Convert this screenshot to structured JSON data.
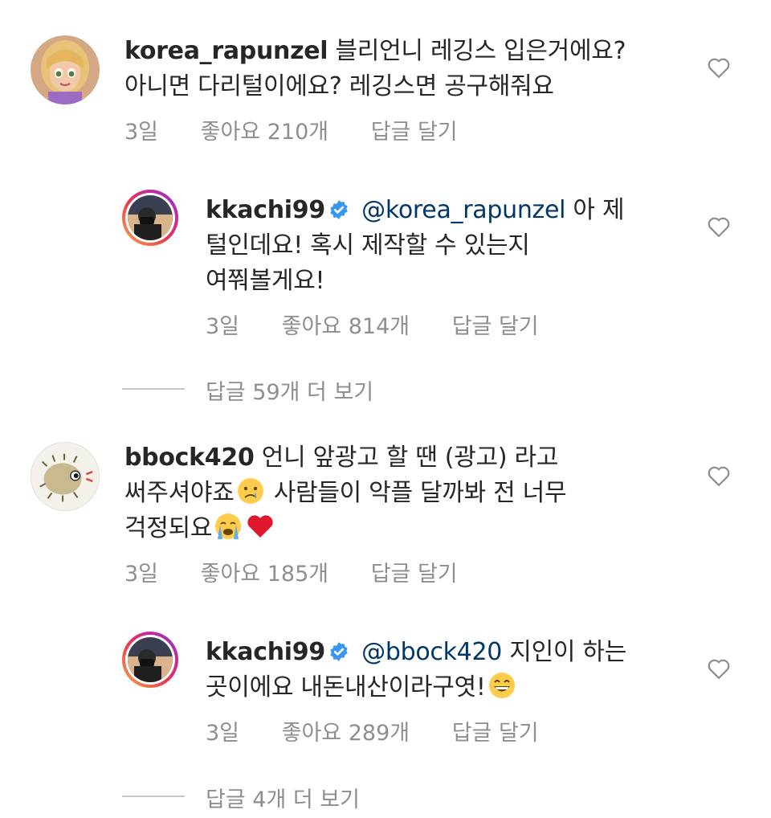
{
  "comments": [
    {
      "username": "korea_rapunzel",
      "line1_rest": " 블리언니 레깅스 입은거에요?",
      "line2": "아니면 다리털이에요? 레깅스면 공구해줘요",
      "time": "3일",
      "likes": "좋아요 210개",
      "reply": "답글 달기",
      "icon": "heart-outline-icon",
      "replies": [
        {
          "username": "kkachi99",
          "mention": "@korea_rapunzel",
          "line1_rest": " 아 제",
          "line2": "털인데요! 혹시 제작할 수 있는지",
          "line3": "여쭤볼게요!",
          "time": "3일",
          "likes": "좋아요 814개",
          "reply": "답글 달기"
        }
      ],
      "view_more": "답글 59개 더 보기"
    },
    {
      "username": "bbock420",
      "line1_rest": " 언니 앞광고 할 땐 (광고) 라고",
      "line2a": "써주셔야죠",
      "line2b": " 사람들이 악플 달까봐 전 너무",
      "line3": "걱정되요",
      "time": "3일",
      "likes": "좋아요 185개",
      "reply": "답글 달기",
      "replies": [
        {
          "username": "kkachi99",
          "mention": "@bbock420",
          "line1_rest": " 지인이 하는",
          "line2": "곳이에요 내돈내산이라구엿!",
          "time": "3일",
          "likes": "좋아요 289개",
          "reply": "답글 달기"
        }
      ],
      "view_more": "답글 4개 더 보기"
    }
  ],
  "colors": {
    "text": "#262626",
    "meta": "#8e8e8e",
    "mention": "#00376b",
    "verified": "#3897f0",
    "heart_emoji": "#e0182d"
  }
}
